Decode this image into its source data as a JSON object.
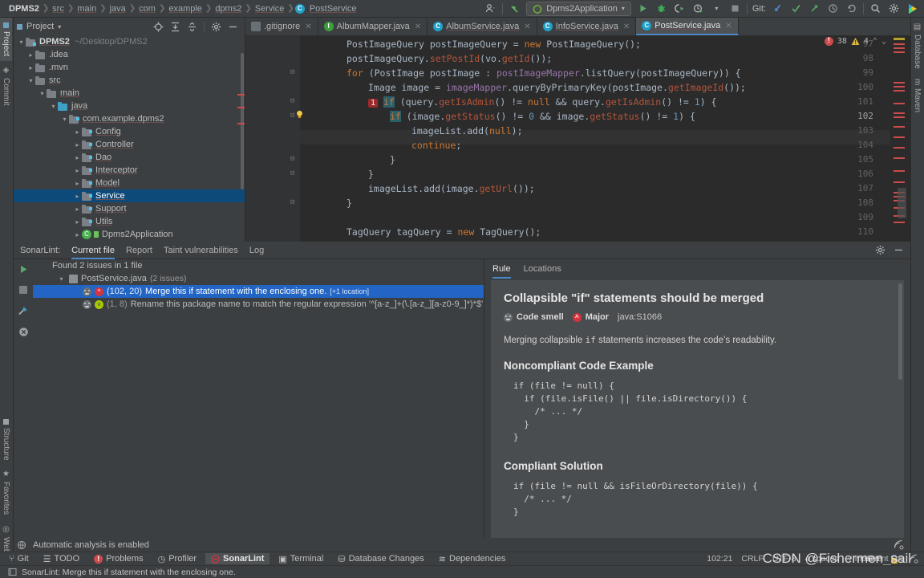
{
  "navbar": {
    "breadcrumbs": [
      "DPMS2",
      "src",
      "main",
      "java",
      "com",
      "example",
      "dpms2",
      "Service",
      "PostService"
    ],
    "run_config": "Dpms2Application",
    "git_label": "Git:",
    "icons": [
      "profile-icon",
      "undo-icon",
      "run-icon",
      "debug-icon",
      "run-coverage-icon",
      "profile-run-icon",
      "stop-icon",
      "git-update-icon",
      "git-commit-icon",
      "git-push-icon",
      "history-icon",
      "rollback-icon",
      "search-everywhere-icon",
      "settings-icon",
      "ide-icon"
    ]
  },
  "left_rail": {
    "top": [
      "Project",
      "Commit"
    ],
    "bottom": [
      "Structure",
      "Favorites",
      "Web"
    ]
  },
  "right_rail": {
    "top": [
      "Database",
      "Maven"
    ]
  },
  "project_panel": {
    "title": "Project",
    "tree": [
      {
        "indent": 0,
        "arrow": "v",
        "label": "DPMS2",
        "path": "~/Desktop/DPMS2",
        "icon": "module-folder",
        "bold": true
      },
      {
        "indent": 1,
        "arrow": ">",
        "label": ".idea",
        "icon": "folder"
      },
      {
        "indent": 1,
        "arrow": ">",
        "label": ".mvn",
        "icon": "folder"
      },
      {
        "indent": 1,
        "arrow": "v",
        "label": "src",
        "icon": "folder"
      },
      {
        "indent": 2,
        "arrow": "v",
        "label": "main",
        "icon": "folder"
      },
      {
        "indent": 3,
        "arrow": "v",
        "label": "java",
        "icon": "source-folder"
      },
      {
        "indent": 4,
        "arrow": "v",
        "label": "com.example.dpms2",
        "icon": "package"
      },
      {
        "indent": 5,
        "arrow": ">",
        "label": "Config",
        "icon": "package"
      },
      {
        "indent": 5,
        "arrow": ">",
        "label": "Controller",
        "icon": "package"
      },
      {
        "indent": 5,
        "arrow": ">",
        "label": "Dao",
        "icon": "package"
      },
      {
        "indent": 5,
        "arrow": ">",
        "label": "Interceptor",
        "icon": "package"
      },
      {
        "indent": 5,
        "arrow": ">",
        "label": "Model",
        "icon": "package"
      },
      {
        "indent": 5,
        "arrow": ">",
        "label": "Service",
        "icon": "package",
        "selected": true
      },
      {
        "indent": 5,
        "arrow": ">",
        "label": "Support",
        "icon": "package"
      },
      {
        "indent": 5,
        "arrow": ">",
        "label": "Utils",
        "icon": "package"
      },
      {
        "indent": 5,
        "arrow": ">",
        "label": "Dpms2Application",
        "icon": "spring-class"
      }
    ]
  },
  "editor": {
    "tabs": [
      {
        "label": ".gitignore",
        "icon": "git-file-icon",
        "active": false,
        "underline": false
      },
      {
        "label": "AlbumMapper.java",
        "icon": "interface-icon",
        "active": false,
        "underline": false
      },
      {
        "label": "AlbumService.java",
        "icon": "class-icon",
        "active": false,
        "underline": true
      },
      {
        "label": "InfoService.java",
        "icon": "class-icon",
        "active": false,
        "underline": true
      },
      {
        "label": "PostService.java",
        "icon": "class-icon",
        "active": true,
        "underline": true
      }
    ],
    "inspections": {
      "errors": "38",
      "warnings": "4"
    },
    "lines": [
      {
        "n": "97",
        "text": "PostImageQuery postImageQuery = new PostImageQuery();"
      },
      {
        "n": "98",
        "text": "postImageQuery.setPostId(vo.getId());"
      },
      {
        "n": "99",
        "text": "for (PostImage postImage : postImageMapper.listQuery(postImageQuery)) {"
      },
      {
        "n": "100",
        "text": "Image image = imageMapper.queryByPrimaryKey(postImage.getImageId());"
      },
      {
        "n": "101",
        "text": "if (query.getIsAdmin() != null && query.getIsAdmin() != 1) {"
      },
      {
        "n": "102",
        "text": "if (image.getStatus() != 0 && image.getStatus() != 1) {"
      },
      {
        "n": "103",
        "text": "imageList.add(null);"
      },
      {
        "n": "104",
        "text": "continue;"
      },
      {
        "n": "105",
        "text": "}"
      },
      {
        "n": "106",
        "text": "}"
      },
      {
        "n": "107",
        "text": "imageList.add(image.getUrl());"
      },
      {
        "n": "108",
        "text": "}"
      },
      {
        "n": "109",
        "text": ""
      },
      {
        "n": "110",
        "text": "TagQuery tagQuery = new TagQuery();"
      }
    ]
  },
  "sonarlint": {
    "title": "SonarLint:",
    "tabs": [
      "Current file",
      "Report",
      "Taint vulnerabilities",
      "Log"
    ],
    "active_tab": "Current file",
    "summary": "Found 2 issues in 1 file",
    "file_node": {
      "name": "PostService.java",
      "count": "(2 issues)"
    },
    "issues": [
      {
        "coord": "(102, 20)",
        "message": "Merge this if statement with the enclosing one.",
        "location": "[+1 location]",
        "severity": "major",
        "selected": true
      },
      {
        "coord": "(1, 8)",
        "message": "Rename this package name to match the regular expression '^[a-z_]+(\\.[a-z_][a-z0-9_]*)*$'",
        "location": "",
        "severity": "minor",
        "selected": false
      }
    ],
    "toolbar_icons": [
      "run-analysis-icon",
      "stop-icon",
      "configure-icon",
      "clear-icon"
    ]
  },
  "rule": {
    "tabs": [
      "Rule",
      "Locations"
    ],
    "active_tab": "Rule",
    "title": "Collapsible \"if\" statements should be merged",
    "badges": {
      "type": "Code smell",
      "severity": "Major",
      "key": "java:S1066"
    },
    "description": "Merging collapsible if statements increases the code's readability.",
    "noncompliant_heading": "Noncompliant Code Example",
    "noncompliant_code": "if (file != null) {\n  if (file.isFile() || file.isDirectory()) {\n    /* ... */\n  }\n}",
    "compliant_heading": "Compliant Solution",
    "compliant_code": "if (file != null && isFileOrDirectory(file)) {\n  /* ... */\n}"
  },
  "bottom": {
    "auto_analysis": "Automatic analysis is enabled",
    "tool_windows": [
      {
        "label": "Git",
        "icon": "git-icon",
        "active": false
      },
      {
        "label": "TODO",
        "icon": "todo-icon",
        "active": false
      },
      {
        "label": "Problems",
        "icon": "problems-icon",
        "active": false
      },
      {
        "label": "Profiler",
        "icon": "profiler-icon",
        "active": false
      },
      {
        "label": "SonarLint",
        "icon": "sonarlint-icon",
        "active": true
      },
      {
        "label": "Terminal",
        "icon": "terminal-icon",
        "active": false
      },
      {
        "label": "Database Changes",
        "icon": "database-changes-icon",
        "active": false
      },
      {
        "label": "Dependencies",
        "icon": "dependencies-icon",
        "active": false
      }
    ],
    "status_message": "SonarLint: Merge this if statement with the enclosing one.",
    "caret": "102:21",
    "line_sep": "CRLF",
    "encoding": "UTF-8",
    "indent": "4 spaces",
    "branch": "master",
    "event_log": "Event Log",
    "watermark": "CSDN @Fishermen_sail"
  },
  "colors": {
    "accent": "#4a88c7",
    "selection": "#2265c4",
    "error": "#cc4b4b",
    "warning": "#b5a12b",
    "major": "#d4333f",
    "minor": "#a6c900"
  }
}
